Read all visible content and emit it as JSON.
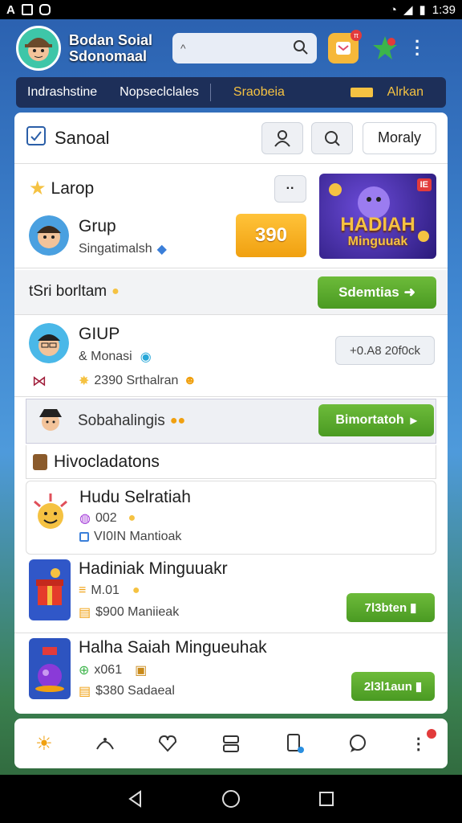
{
  "status": {
    "left_icons": [
      "A",
      "E",
      "D"
    ],
    "time": "1:39"
  },
  "header": {
    "app_name_line1": "Bodan Soial",
    "app_name_line2": "Sdonomaal",
    "search_placeholder": "^",
    "badge_text": "π"
  },
  "tabs": [
    "Indrashstine",
    "Nopseclclales",
    "Sraobeia",
    "Alrkan"
  ],
  "panel": {
    "title": "Sanoal",
    "btn_more": "Moraly"
  },
  "card_top": {
    "heading": "Larop",
    "more": "··",
    "name": "Grup",
    "sub": "Singatimalsh",
    "value": "390",
    "banner_line1": "HADIAH",
    "banner_line2": "Minguuak",
    "banner_badge": "IE"
  },
  "bar1": {
    "label": "tSri borltam",
    "button": "Sdemtias"
  },
  "card_group": {
    "name": "GIUP",
    "sub": "& Monasi",
    "stat": "2390 Srthalran",
    "pill": "+0.A8 20f0ck"
  },
  "bar2": {
    "label": "Sobahalingis",
    "button": "Bimortatoh"
  },
  "section": {
    "title": "Hivocladatons"
  },
  "items": [
    {
      "title": "Hudu Selratiah",
      "l1": "002",
      "l2": "VI0IN Mantioak",
      "button": ""
    },
    {
      "title": "Hadiniak Minguuakr",
      "l1": "M.01",
      "l2": "$900 Maniieak",
      "button": "7l3bten"
    },
    {
      "title": "Halha Saiah Mingueuhak",
      "l1": "x061",
      "l2": "$380 Sadaeal",
      "button": "2l3l1aun"
    }
  ],
  "colors": {
    "accent_green": "#5aa82c",
    "value_orange": "#f5a623",
    "nav_dark": "#1d2f59"
  },
  "bottom_nav_icons": [
    "sun-face-icon",
    "share-icon",
    "heart-icon",
    "stack-icon",
    "phone-icon",
    "chat-icon",
    "more-dots-icon"
  ]
}
